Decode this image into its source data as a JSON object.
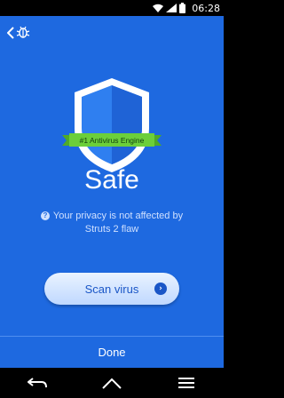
{
  "status_bar": {
    "time": "06:28"
  },
  "ribbon": {
    "text": "#1 Antivirus Engine"
  },
  "main": {
    "status_title": "Safe",
    "info_text": "Your privacy is not affected by Struts 2 flaw"
  },
  "scan_button": {
    "label": "Scan virus"
  },
  "done_button": {
    "label": "Done"
  },
  "colors": {
    "background": "#1e69e0",
    "ribbon": "#6ccf3a",
    "button_text": "#1a56c7"
  },
  "icons": {
    "back": "chevron-left-icon",
    "bug": "bug-icon",
    "shield": "shield-icon",
    "help": "help-circle-icon",
    "arrow": "arrow-right-icon"
  }
}
